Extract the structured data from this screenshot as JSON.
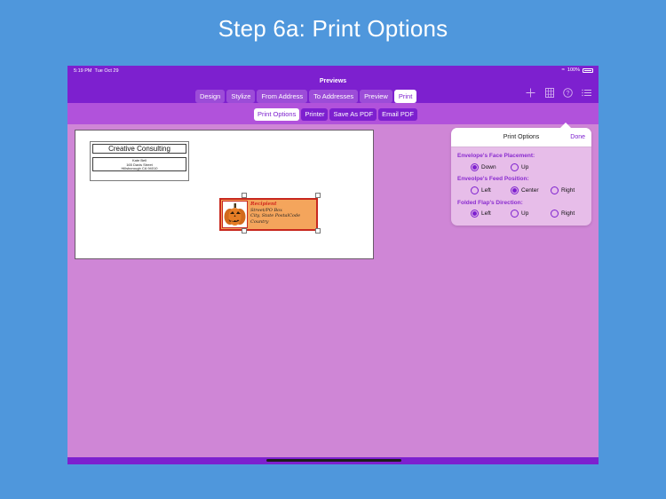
{
  "page_title": "Step 6a: Print Options",
  "status": {
    "time": "5:19 PM",
    "date": "Tue Oct 29",
    "battery": "100%"
  },
  "nav": {
    "title": "Previews",
    "tabs": [
      {
        "label": "Design",
        "selected": false
      },
      {
        "label": "Stylize",
        "selected": false
      },
      {
        "label": "From Address",
        "selected": false
      },
      {
        "label": "To Addresses",
        "selected": false
      },
      {
        "label": "Preview",
        "selected": false
      },
      {
        "label": "Print",
        "selected": true
      }
    ],
    "icons": [
      "move-icon",
      "grid-icon",
      "help-icon",
      "list-icon"
    ]
  },
  "subtabs": [
    {
      "label": "Print Options",
      "selected": true
    },
    {
      "label": "Printer",
      "selected": false
    },
    {
      "label": "Save As PDF",
      "selected": false
    },
    {
      "label": "Email PDF",
      "selected": false
    }
  ],
  "envelope": {
    "company": "Creative Consulting",
    "return_lines": [
      "Kate Bell",
      "165 Davis Street",
      "Hillsborough CA 94010"
    ],
    "label": {
      "lines": [
        "Recipient",
        "Street/PO Box",
        "City, State PostalCode",
        "Country"
      ],
      "image_icon": "pumpkin-icon"
    }
  },
  "popover": {
    "title": "Print Options",
    "done": "Done",
    "sections": [
      {
        "label": "Envelope's Face Placement:",
        "options": [
          "Down",
          "Up"
        ],
        "selected": 0
      },
      {
        "label": "Enveolpe's Feed Position:",
        "options": [
          "Left",
          "Center",
          "Right"
        ],
        "selected": 1
      },
      {
        "label": "Folded Flap's Direction:",
        "options": [
          "Left",
          "Up",
          "Right"
        ],
        "selected": 0
      }
    ]
  },
  "colors": {
    "accent": "#7d20cf",
    "canvas": "#cf86d6",
    "background": "#4f97dc"
  }
}
